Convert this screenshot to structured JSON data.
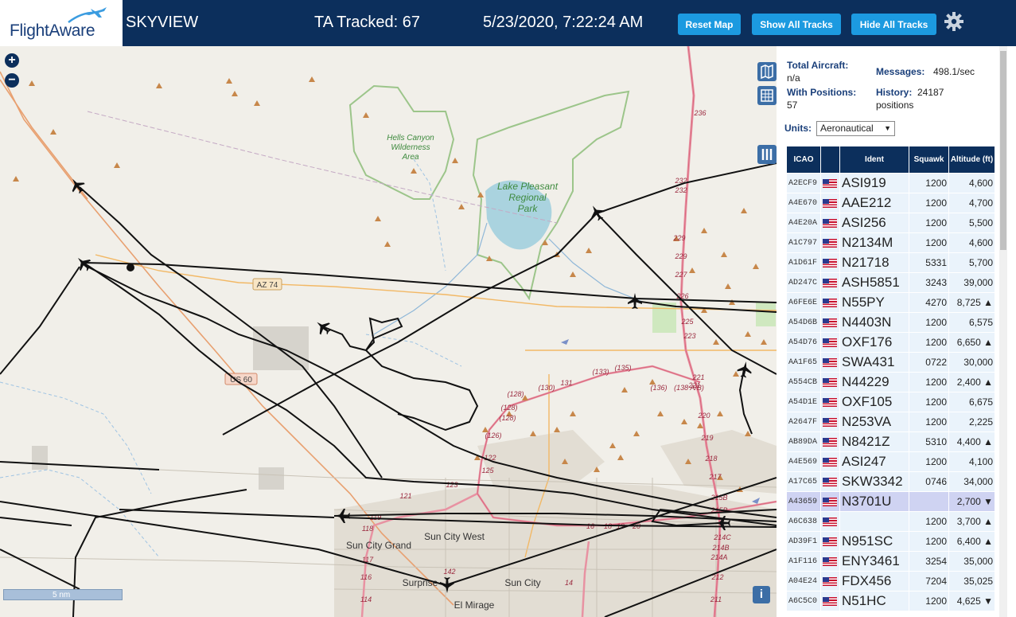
{
  "brand": {
    "logo_text": "FlightAware"
  },
  "header": {
    "app_title": "SKYVIEW",
    "ta_tracked": "TA Tracked: 67",
    "datetime": "5/23/2020, 7:22:24 AM",
    "buttons": {
      "reset": "Reset Map",
      "show_all": "Show All Tracks",
      "hide_all": "Hide All Tracks"
    },
    "settings_icon": "gear-icon"
  },
  "map": {
    "zoom_in": "+",
    "zoom_out": "−",
    "scale": "5 nm",
    "info": "i",
    "labels": {
      "hells_canyon": [
        "Hells Canyon",
        "Wilderness",
        "Area"
      ],
      "lake_pleasant": [
        "Lake Pleasant",
        "Regional",
        "Park"
      ],
      "az74": "AZ 74",
      "us60": "US 60",
      "sun_city_grand": "Sun City Grand",
      "sun_city_west": "Sun City West",
      "sun_city": "Sun City",
      "surprise": "Surprise",
      "el_mirage": "El Mirage"
    },
    "road_numbers": [
      "236",
      "232",
      "232",
      "229",
      "229",
      "227",
      "226",
      "225",
      "223",
      "221",
      "221",
      "220",
      "219",
      "218",
      "217",
      "215B",
      "215B",
      "214C",
      "214B",
      "214A",
      "212",
      "211",
      "(128)",
      "(128)",
      "(128)",
      "(126)",
      "(130)",
      "131",
      "(133)",
      "(135)",
      "(136)",
      "(138 A/B)",
      "125",
      "123",
      "121",
      "122",
      "119",
      "118",
      "117",
      "116",
      "114",
      "142",
      "14",
      "16",
      "18",
      "19",
      "20"
    ]
  },
  "stats": {
    "total_aircraft_label": "Total Aircraft:",
    "total_aircraft_value": "n/a",
    "with_positions_label": "With Positions:",
    "with_positions_value": "57",
    "messages_label": "Messages:",
    "messages_value": "498.1/sec",
    "history_label": "History:",
    "history_value": "24187",
    "history_unit": "positions",
    "units_label": "Units:",
    "units_value": "Aeronautical"
  },
  "table": {
    "columns": [
      "ICAO",
      "",
      "Ident",
      "Squawk",
      "Altitude (ft)"
    ],
    "rows": [
      {
        "icao": "A2ECF9",
        "ident": "ASI919",
        "squawk": "1200",
        "alt": "4,600"
      },
      {
        "icao": "A4E670",
        "ident": "AAE212",
        "squawk": "1200",
        "alt": "4,700"
      },
      {
        "icao": "A4E20A",
        "ident": "ASI256",
        "squawk": "1200",
        "alt": "5,500"
      },
      {
        "icao": "A1C797",
        "ident": "N2134M",
        "squawk": "1200",
        "alt": "4,600"
      },
      {
        "icao": "A1D61F",
        "ident": "N21718",
        "squawk": "5331",
        "alt": "5,700"
      },
      {
        "icao": "AD247C",
        "ident": "ASH5851",
        "squawk": "3243",
        "alt": "39,000"
      },
      {
        "icao": "A6FE6E",
        "ident": "N55PY",
        "squawk": "4270",
        "alt": "8,725 ▲"
      },
      {
        "icao": "A54D6B",
        "ident": "N4403N",
        "squawk": "1200",
        "alt": "6,575"
      },
      {
        "icao": "A54D76",
        "ident": "OXF176",
        "squawk": "1200",
        "alt": "6,650 ▲"
      },
      {
        "icao": "AA1F65",
        "ident": "SWA431",
        "squawk": "0722",
        "alt": "30,000"
      },
      {
        "icao": "A554CB",
        "ident": "N44229",
        "squawk": "1200",
        "alt": "2,400 ▲"
      },
      {
        "icao": "A54D1E",
        "ident": "OXF105",
        "squawk": "1200",
        "alt": "6,675"
      },
      {
        "icao": "A2647F",
        "ident": "N253VA",
        "squawk": "1200",
        "alt": "2,225"
      },
      {
        "icao": "AB89DA",
        "ident": "N8421Z",
        "squawk": "5310",
        "alt": "4,400 ▲"
      },
      {
        "icao": "A4E569",
        "ident": "ASI247",
        "squawk": "1200",
        "alt": "4,100"
      },
      {
        "icao": "A17C65",
        "ident": "SKW3342",
        "squawk": "0746",
        "alt": "34,000"
      },
      {
        "icao": "A43659",
        "ident": "N3701U",
        "squawk": "",
        "alt": "2,700 ▼"
      },
      {
        "icao": "A6C638",
        "ident": "",
        "squawk": "1200",
        "alt": "3,700 ▲"
      },
      {
        "icao": "AD39F1",
        "ident": "N951SC",
        "squawk": "1200",
        "alt": "6,400 ▲"
      },
      {
        "icao": "A1F116",
        "ident": "ENY3461",
        "squawk": "3254",
        "alt": "35,000"
      },
      {
        "icao": "A04E24",
        "ident": "FDX456",
        "squawk": "7204",
        "alt": "35,025"
      },
      {
        "icao": "A6C5C0",
        "ident": "N51HC",
        "squawk": "1200",
        "alt": "4,625 ▼"
      }
    ],
    "selected_icao": "A43659"
  }
}
